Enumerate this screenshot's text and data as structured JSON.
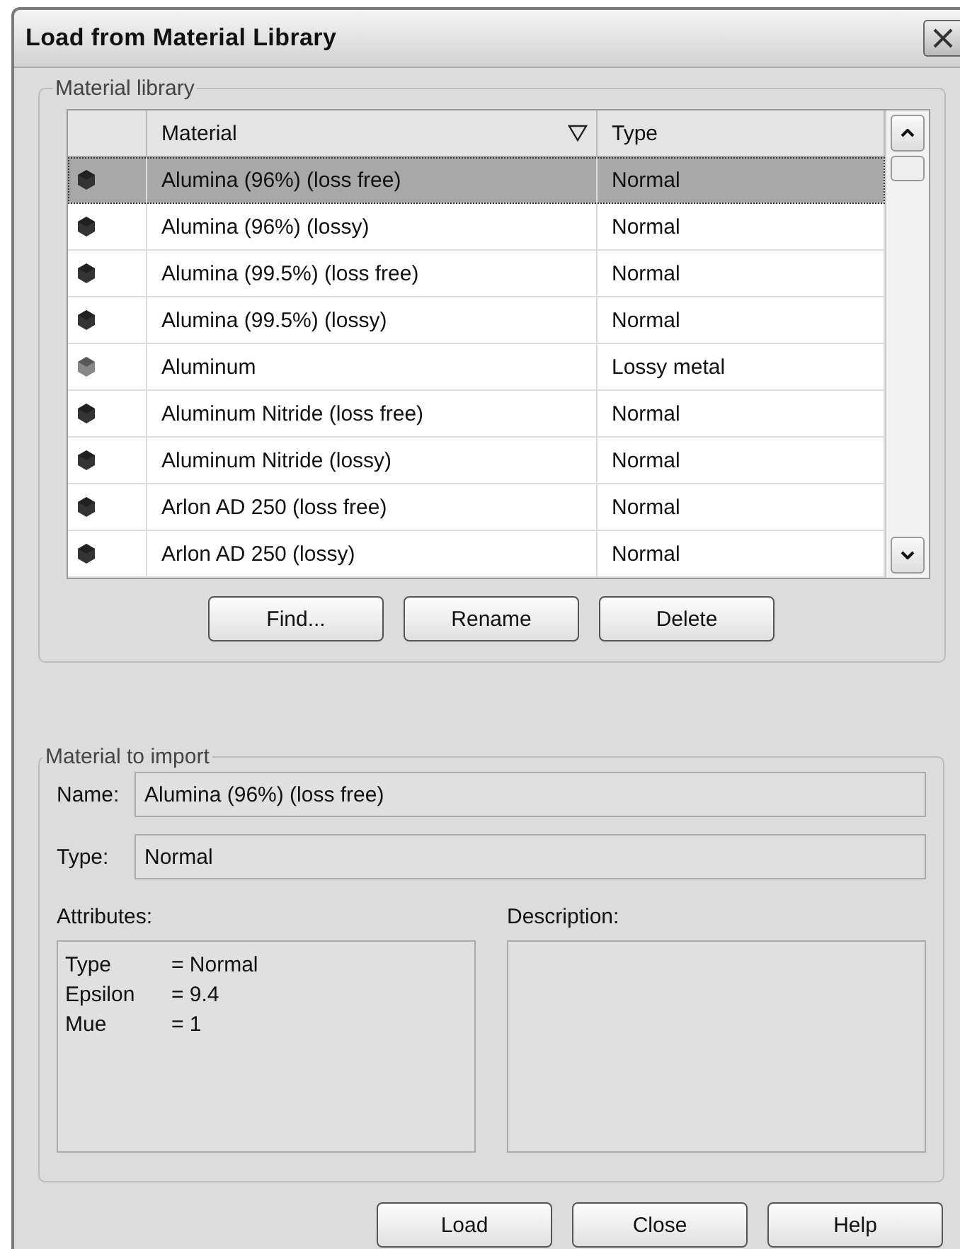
{
  "window": {
    "title": "Load from Material Library"
  },
  "library": {
    "legend": "Material library",
    "columns": [
      "Material",
      "Type"
    ],
    "rows": [
      {
        "material": "Alumina (96%) (loss free)",
        "type": "Normal",
        "kind": "dielectric",
        "selected": true
      },
      {
        "material": "Alumina (96%) (lossy)",
        "type": "Normal",
        "kind": "dielectric",
        "selected": false
      },
      {
        "material": "Alumina (99.5%) (loss free)",
        "type": "Normal",
        "kind": "dielectric",
        "selected": false
      },
      {
        "material": "Alumina (99.5%) (lossy)",
        "type": "Normal",
        "kind": "dielectric",
        "selected": false
      },
      {
        "material": "Aluminum",
        "type": "Lossy metal",
        "kind": "metal",
        "selected": false
      },
      {
        "material": "Aluminum Nitride (loss free)",
        "type": "Normal",
        "kind": "dielectric",
        "selected": false
      },
      {
        "material": "Aluminum Nitride (lossy)",
        "type": "Normal",
        "kind": "dielectric",
        "selected": false
      },
      {
        "material": "Arlon AD 250 (loss free)",
        "type": "Normal",
        "kind": "dielectric",
        "selected": false
      },
      {
        "material": "Arlon AD 250 (lossy)",
        "type": "Normal",
        "kind": "dielectric",
        "selected": false
      }
    ],
    "buttons": [
      "Find...",
      "Rename",
      "Delete"
    ]
  },
  "import": {
    "legend": "Material to import",
    "name_label": "Name:",
    "name_value": "Alumina (96%) (loss free)",
    "type_label": "Type:",
    "type_value": "Normal",
    "attributes_label": "Attributes:",
    "attributes": [
      {
        "name": "Type",
        "value": "= Normal"
      },
      {
        "name": "Epsilon",
        "value": "= 9.4"
      },
      {
        "name": "Mue",
        "value": "= 1"
      }
    ],
    "description_label": "Description:"
  },
  "buttons": [
    "Load",
    "Close",
    "Help"
  ]
}
